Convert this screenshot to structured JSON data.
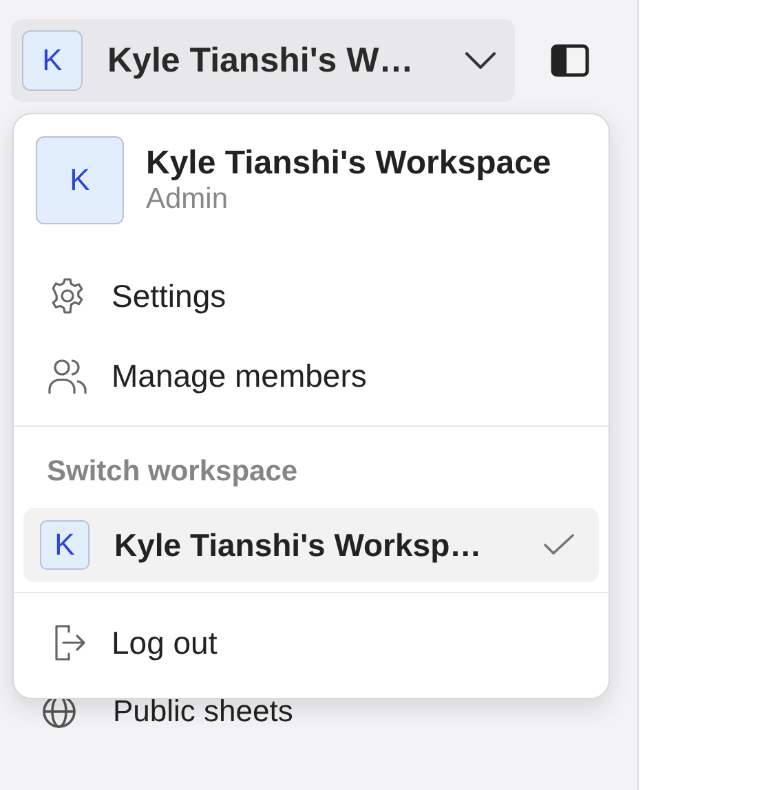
{
  "workspace_button": {
    "avatar": "K",
    "title": "Kyle Tianshi's W…"
  },
  "sidebar": {
    "items": [
      {
        "label": "Public sheets",
        "kind": "globe"
      }
    ]
  },
  "menu": {
    "header": {
      "avatar": "K",
      "name": "Kyle Tianshi's Workspace",
      "role": "Admin"
    },
    "actions": [
      {
        "label": "Settings",
        "kind": "gear"
      },
      {
        "label": "Manage members",
        "kind": "people"
      }
    ],
    "section_title": "Switch workspace",
    "workspaces": [
      {
        "avatar": "K",
        "name": "Kyle Tianshi's Worksp…",
        "selected": true
      }
    ],
    "footer_actions": [
      {
        "label": "Log out",
        "kind": "logout"
      }
    ]
  }
}
